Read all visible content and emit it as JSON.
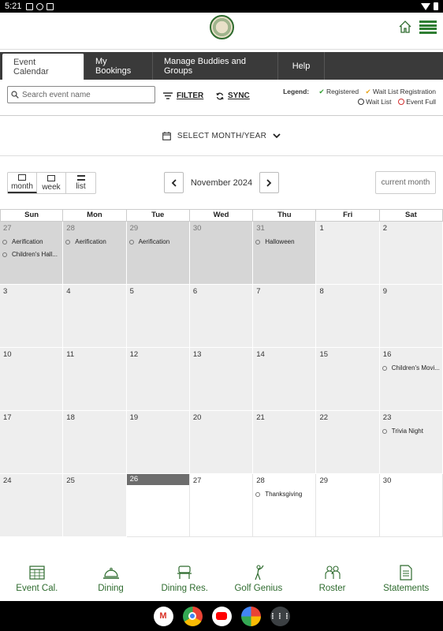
{
  "status_bar": {
    "time": "5:21"
  },
  "tabs": [
    {
      "label": "Event Calendar",
      "active": true
    },
    {
      "label": "My Bookings",
      "active": false
    },
    {
      "label": "Manage Buddies and Groups",
      "active": false
    },
    {
      "label": "Help",
      "active": false
    }
  ],
  "search": {
    "placeholder": "Search event name",
    "value": ""
  },
  "toolbar": {
    "filter_label": "FILTER",
    "sync_label": "SYNC"
  },
  "legend": {
    "label": "Legend:",
    "registered": "Registered",
    "wait_list_registration": "Wait List Registration",
    "wait_list": "Wait List",
    "event_full": "Event Full"
  },
  "month_select": {
    "label": "SELECT MONTH/YEAR"
  },
  "views": [
    {
      "label": "month",
      "active": true
    },
    {
      "label": "week",
      "active": false
    },
    {
      "label": "list",
      "active": false
    }
  ],
  "nav": {
    "title": "November 2024",
    "current_month_label": "current month"
  },
  "calendar": {
    "days_of_week": [
      "Sun",
      "Mon",
      "Tue",
      "Wed",
      "Thu",
      "Fri",
      "Sat"
    ],
    "weeks": [
      [
        {
          "day": "27",
          "outside": true,
          "events": [
            "Aerification",
            "Children's Hall..."
          ]
        },
        {
          "day": "28",
          "outside": true,
          "events": [
            "Aerification"
          ]
        },
        {
          "day": "29",
          "outside": true,
          "events": [
            "Aerification"
          ]
        },
        {
          "day": "30",
          "outside": true,
          "events": []
        },
        {
          "day": "31",
          "outside": true,
          "events": [
            "Halloween"
          ]
        },
        {
          "day": "1",
          "events": []
        },
        {
          "day": "2",
          "events": []
        }
      ],
      [
        {
          "day": "3",
          "events": []
        },
        {
          "day": "4",
          "events": []
        },
        {
          "day": "5",
          "events": []
        },
        {
          "day": "6",
          "events": []
        },
        {
          "day": "7",
          "events": []
        },
        {
          "day": "8",
          "events": []
        },
        {
          "day": "9",
          "events": []
        }
      ],
      [
        {
          "day": "10",
          "events": []
        },
        {
          "day": "11",
          "events": []
        },
        {
          "day": "12",
          "events": []
        },
        {
          "day": "13",
          "events": []
        },
        {
          "day": "14",
          "events": []
        },
        {
          "day": "15",
          "events": []
        },
        {
          "day": "16",
          "events": [
            "Children's Movi..."
          ]
        }
      ],
      [
        {
          "day": "17",
          "events": []
        },
        {
          "day": "18",
          "events": []
        },
        {
          "day": "19",
          "events": []
        },
        {
          "day": "20",
          "events": []
        },
        {
          "day": "21",
          "events": []
        },
        {
          "day": "22",
          "events": []
        },
        {
          "day": "23",
          "events": [
            "Trivia Night"
          ]
        }
      ],
      [
        {
          "day": "24",
          "events": []
        },
        {
          "day": "25",
          "events": []
        },
        {
          "day": "26",
          "today": true,
          "white": true,
          "events": []
        },
        {
          "day": "27",
          "white": true,
          "events": []
        },
        {
          "day": "28",
          "white": true,
          "events": [
            "Thanksgiving"
          ]
        },
        {
          "day": "29",
          "white": true,
          "events": []
        },
        {
          "day": "30",
          "white": true,
          "events": []
        }
      ]
    ]
  },
  "bottom_nav": [
    {
      "label": "Event Cal.",
      "icon": "calendar-grid-icon"
    },
    {
      "label": "Dining",
      "icon": "cloche-icon"
    },
    {
      "label": "Dining Res.",
      "icon": "reservation-icon"
    },
    {
      "label": "Golf Genius",
      "icon": "golfer-icon"
    },
    {
      "label": "Roster",
      "icon": "people-icon"
    },
    {
      "label": "Statements",
      "icon": "document-icon"
    }
  ],
  "dock": [
    {
      "name": "Gmail",
      "icon": "gmail-icon",
      "color": "#d93025"
    },
    {
      "name": "Chrome",
      "icon": "chrome-icon",
      "color": "#1a73e8"
    },
    {
      "name": "YouTube",
      "icon": "youtube-icon",
      "color": "#ff0000"
    },
    {
      "name": "Photos",
      "icon": "photos-icon",
      "color": "#fbbc04"
    },
    {
      "name": "Apps",
      "icon": "app-drawer-icon",
      "color": "#3c4043"
    }
  ],
  "colors": {
    "brand_green": "#2e6b2e",
    "tab_bar": "#3a3a3a",
    "today": "#6d6d6d"
  }
}
